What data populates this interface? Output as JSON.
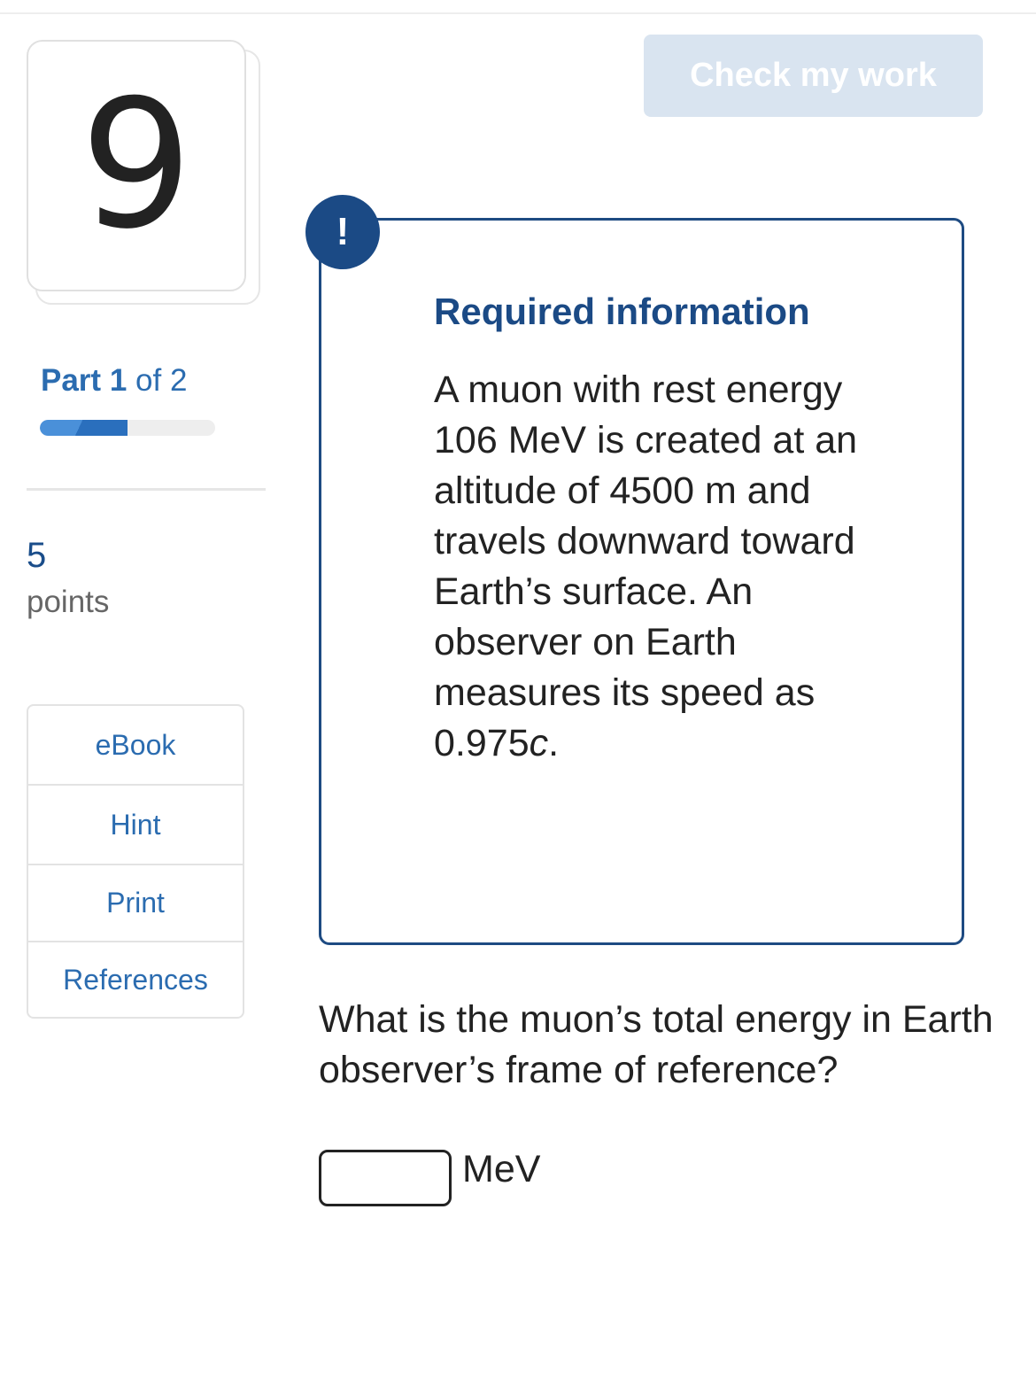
{
  "question": {
    "number": "9",
    "part_prefix": "Part",
    "part_current": "1",
    "part_suffix": "of 2",
    "progress_fraction": 0.5,
    "points_value": "5",
    "points_label": "points"
  },
  "tools": [
    {
      "label": "eBook"
    },
    {
      "label": "Hint"
    },
    {
      "label": "Print"
    },
    {
      "label": "References"
    }
  ],
  "header": {
    "check_button_label": "Check my work"
  },
  "info": {
    "badge_icon": "!",
    "title": "Required information",
    "text_main": "A muon with rest energy 106 MeV is created at an altitude of 4500 m and travels downward toward Earth’s surface. An observer on Earth measures its speed as 0.975",
    "text_var": "c",
    "text_end": "."
  },
  "prompt": {
    "text": "What is the muon’s total energy in Earth observer’s frame of reference?",
    "answer_value": "",
    "unit": "MeV"
  },
  "colors": {
    "accent": "#2b6cb0",
    "navy": "#1b4a85",
    "button_disabled": "#d9e4f0"
  }
}
